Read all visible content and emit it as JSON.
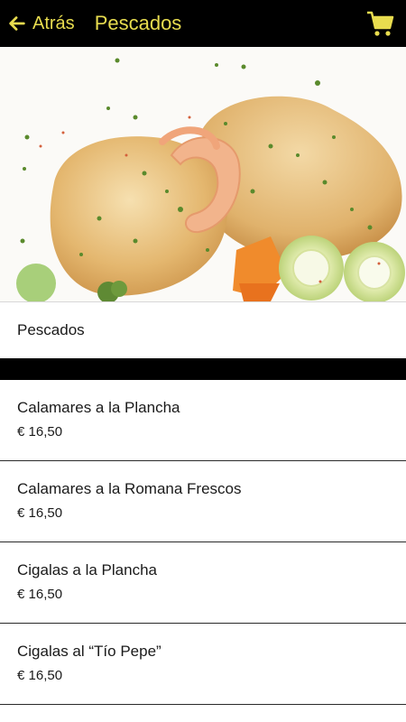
{
  "header": {
    "back_label": "Atrás",
    "title": "Pescados",
    "accent_color": "#e8dc4f",
    "back_icon": "arrow-left-icon",
    "cart_icon": "shopping-cart-icon"
  },
  "hero": {
    "description_icon": "fish-dish-photo"
  },
  "category": {
    "label": "Pescados"
  },
  "items": [
    {
      "name": "Calamares a la Plancha",
      "price": "€ 16,50"
    },
    {
      "name": "Calamares a la Romana Frescos",
      "price": "€ 16,50"
    },
    {
      "name": "Cigalas a la Plancha",
      "price": "€ 16,50"
    },
    {
      "name": "Cigalas al “Tío Pepe”",
      "price": "€ 16,50"
    }
  ]
}
